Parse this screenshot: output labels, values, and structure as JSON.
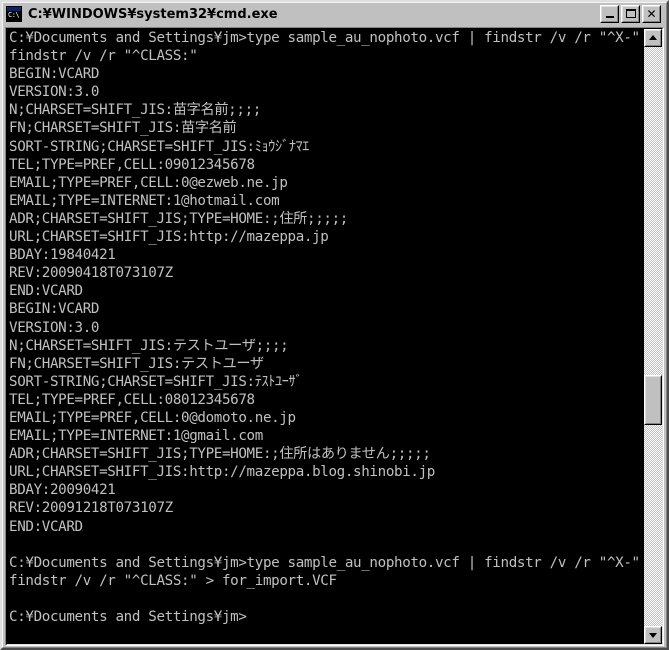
{
  "window": {
    "title": "C:¥WINDOWS¥system32¥cmd.exe",
    "icon_name": "cmd-console-icon",
    "icon_text": "C:\\",
    "minimize_label": "_",
    "maximize_label": "□",
    "close_label": "✕",
    "background_color": "#c0c0c0",
    "console_background": "#000000",
    "console_foreground": "#c0c0c0",
    "titlebar_accent": "#0a246a"
  },
  "scrollbar": {
    "up_arrow": "▲",
    "down_arrow": "▼",
    "thumb_position_percent": 62
  },
  "console": {
    "lines": [
      "C:¥Documents and Settings¥jm>type sample_au_nophoto.vcf | findstr /v /r \"^X-\" |",
      "findstr /v /r \"^CLASS:\"",
      "BEGIN:VCARD",
      "VERSION:3.0",
      "N;CHARSET=SHIFT_JIS:苗字名前;;;;",
      "FN;CHARSET=SHIFT_JIS:苗字名前",
      "SORT-STRING;CHARSET=SHIFT_JIS:ﾐｮｳｼﾞﾅﾏｴ",
      "TEL;TYPE=PREF,CELL:09012345678",
      "EMAIL;TYPE=PREF,CELL:0@ezweb.ne.jp",
      "EMAIL;TYPE=INTERNET:1@hotmail.com",
      "ADR;CHARSET=SHIFT_JIS;TYPE=HOME:;住所;;;;;",
      "URL;CHARSET=SHIFT_JIS:http://mazeppa.jp",
      "BDAY:19840421",
      "REV:20090418T073107Z",
      "END:VCARD",
      "BEGIN:VCARD",
      "VERSION:3.0",
      "N;CHARSET=SHIFT_JIS:テストユーザ;;;;",
      "FN;CHARSET=SHIFT_JIS:テストユーザ",
      "SORT-STRING;CHARSET=SHIFT_JIS:ﾃｽﾄﾕｰｻﾞ",
      "TEL;TYPE=PREF,CELL:08012345678",
      "EMAIL;TYPE=PREF,CELL:0@domoto.ne.jp",
      "EMAIL;TYPE=INTERNET:1@gmail.com",
      "ADR;CHARSET=SHIFT_JIS;TYPE=HOME:;住所はありません;;;;;",
      "URL;CHARSET=SHIFT_JIS:http://mazeppa.blog.shinobi.jp",
      "BDAY:20090421",
      "REV:20091218T073107Z",
      "END:VCARD",
      "",
      "C:¥Documents and Settings¥jm>type sample_au_nophoto.vcf | findstr /v /r \"^X-\" |",
      "findstr /v /r \"^CLASS:\" > for_import.VCF",
      "",
      "C:¥Documents and Settings¥jm>"
    ]
  }
}
